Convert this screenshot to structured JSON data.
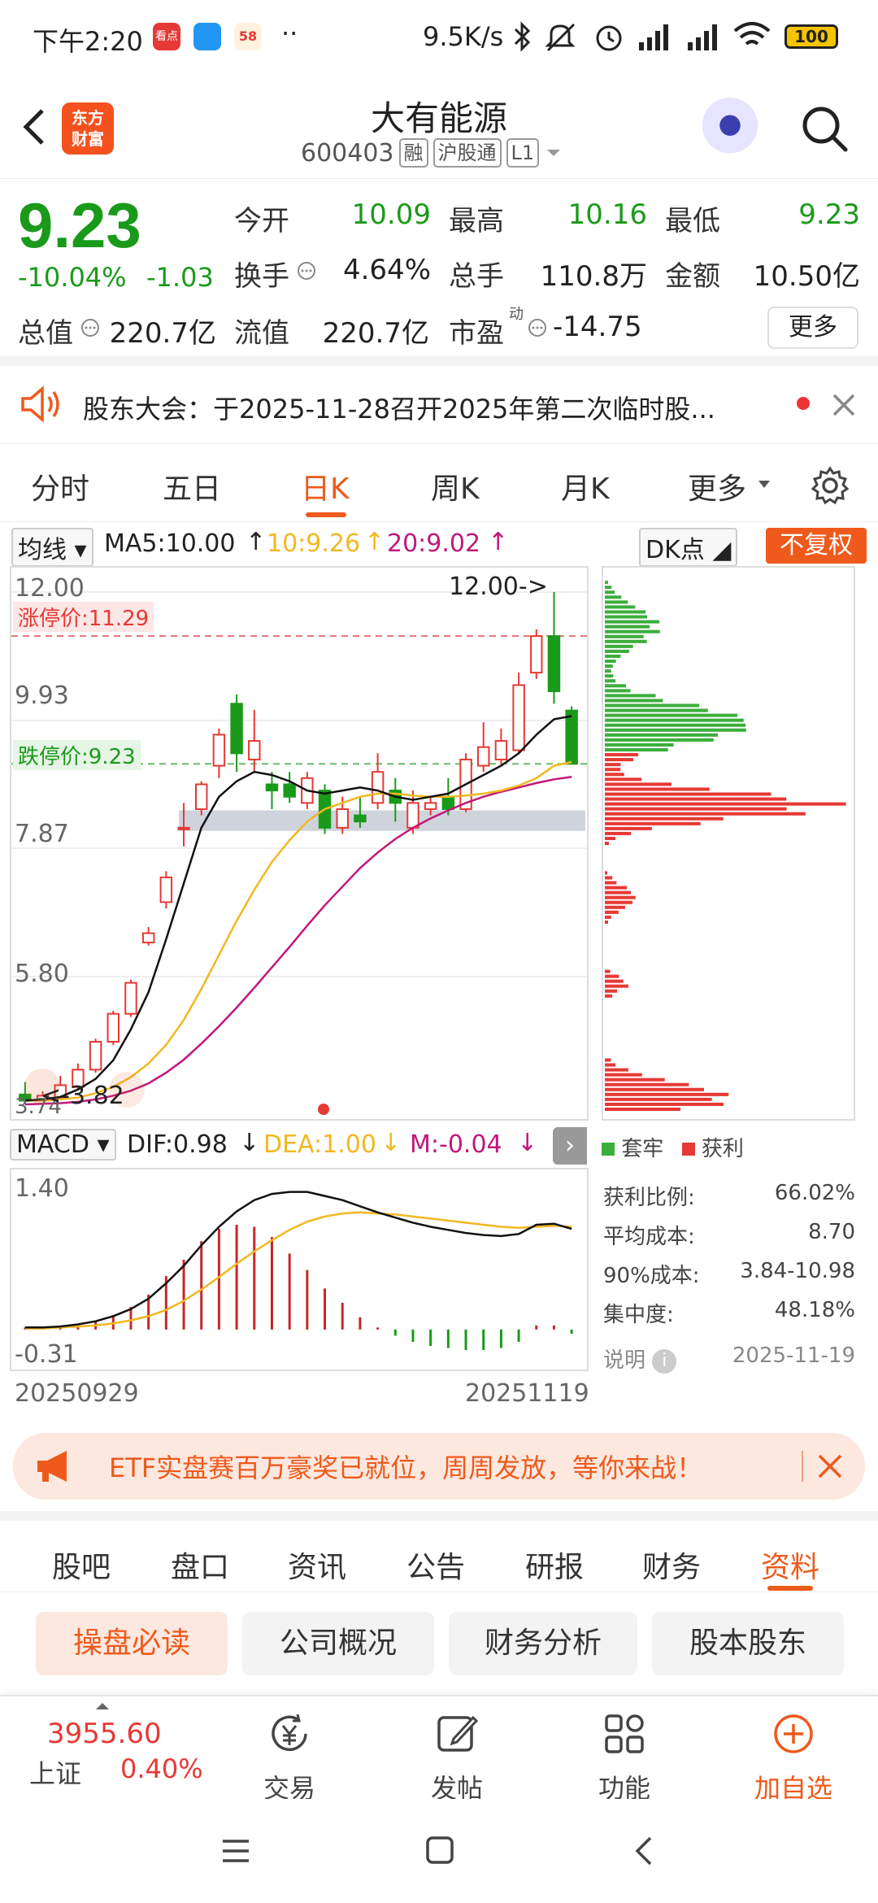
{
  "status_bar": {
    "time": "下午2:20",
    "app_icons": [
      "看点",
      "",
      "58"
    ],
    "dots": "··",
    "network_speed": "9.5K/s",
    "battery": "100"
  },
  "header": {
    "logo_text_1": "东方",
    "logo_text_2": "财富",
    "stock_name": "大有能源",
    "stock_code": "600403",
    "tags": [
      "融",
      "沪股通",
      "L1"
    ]
  },
  "quote": {
    "price": "9.23",
    "change_pct": "-10.04%",
    "change": "-1.03",
    "fields": [
      {
        "label": "今开",
        "value": "10.09",
        "color": "green"
      },
      {
        "label": "最高",
        "value": "10.16",
        "color": "green"
      },
      {
        "label": "最低",
        "value": "9.23",
        "color": "green"
      },
      {
        "label": "换手",
        "value": "4.64%",
        "color": "normal"
      },
      {
        "label": "总手",
        "value": "110.8万",
        "color": "normal"
      },
      {
        "label": "金额",
        "value": "10.50亿",
        "color": "normal"
      },
      {
        "label": "总值",
        "value": "220.7亿",
        "color": "normal"
      },
      {
        "label": "流值",
        "value": "220.7亿",
        "color": "normal"
      },
      {
        "label": "市盈",
        "value": "-14.75",
        "color": "normal"
      }
    ],
    "pe_superscript": "动",
    "more_label": "更多"
  },
  "notice": {
    "text": "股东大会：于2025-11-28召开2025年第二次临时股..."
  },
  "kline_tabs": [
    "分时",
    "五日",
    "日K",
    "周K",
    "月K",
    "更多"
  ],
  "kline_tab_active": "日K",
  "toolbar": {
    "indicator_select": "均线",
    "ma5": "MA5:10.00",
    "ma10": "10:9.26",
    "ma20": "20:9.02",
    "dk_select": "DK点",
    "fq_label": "不复权"
  },
  "main_chart": {
    "y_labels": [
      "12.00",
      "9.93",
      "7.87",
      "5.80",
      "3.74"
    ],
    "limit_up": "涨停价:11.29",
    "limit_down": "跌停价:9.23",
    "high_marker": "12.00->",
    "low_marker": "<-3.82",
    "colors": {
      "up": "#e53935",
      "down": "#1a9a1a",
      "ma5": "#111111",
      "ma10": "#f2b821",
      "ma20": "#c2187a"
    }
  },
  "chart_data": [
    {
      "type": "candlestick",
      "title": "",
      "ylim": [
        3.74,
        12.0
      ],
      "x_labels": [
        "20250929",
        "20251119"
      ],
      "candles": [
        {
          "o": 3.9,
          "c": 3.8,
          "h": 4.1,
          "l": 3.74
        },
        {
          "o": 3.82,
          "c": 3.88,
          "h": 3.95,
          "l": 3.8
        },
        {
          "o": 3.85,
          "c": 4.05,
          "h": 4.2,
          "l": 3.82
        },
        {
          "o": 4.02,
          "c": 4.3,
          "h": 4.4,
          "l": 3.98
        },
        {
          "o": 4.3,
          "c": 4.75,
          "h": 4.8,
          "l": 4.25
        },
        {
          "o": 4.75,
          "c": 5.2,
          "h": 5.25,
          "l": 4.7
        },
        {
          "o": 5.2,
          "c": 5.7,
          "h": 5.75,
          "l": 5.15
        },
        {
          "o": 6.35,
          "c": 6.5,
          "h": 6.6,
          "l": 6.3
        },
        {
          "o": 7.0,
          "c": 7.4,
          "h": 7.5,
          "l": 6.9
        },
        {
          "o": 8.2,
          "c": 8.2,
          "h": 8.6,
          "l": 7.9
        },
        {
          "o": 8.5,
          "c": 8.9,
          "h": 8.95,
          "l": 8.4
        },
        {
          "o": 9.2,
          "c": 9.7,
          "h": 9.8,
          "l": 9.0
        },
        {
          "o": 10.2,
          "c": 9.4,
          "h": 10.35,
          "l": 9.1
        },
        {
          "o": 9.3,
          "c": 9.6,
          "h": 10.1,
          "l": 9.1
        },
        {
          "o": 8.9,
          "c": 8.8,
          "h": 9.1,
          "l": 8.5
        },
        {
          "o": 8.9,
          "c": 8.7,
          "h": 9.1,
          "l": 8.6
        },
        {
          "o": 8.6,
          "c": 9.0,
          "h": 9.1,
          "l": 8.5
        },
        {
          "o": 8.8,
          "c": 8.2,
          "h": 8.9,
          "l": 8.1
        },
        {
          "o": 8.2,
          "c": 8.5,
          "h": 8.7,
          "l": 8.1
        },
        {
          "o": 8.4,
          "c": 8.3,
          "h": 8.7,
          "l": 8.2
        },
        {
          "o": 8.6,
          "c": 9.1,
          "h": 9.4,
          "l": 8.5
        },
        {
          "o": 8.8,
          "c": 8.6,
          "h": 9.0,
          "l": 8.3
        },
        {
          "o": 8.2,
          "c": 8.6,
          "h": 8.8,
          "l": 8.1
        },
        {
          "o": 8.5,
          "c": 8.6,
          "h": 8.7,
          "l": 8.4
        },
        {
          "o": 8.7,
          "c": 8.5,
          "h": 9.0,
          "l": 8.4
        },
        {
          "o": 8.5,
          "c": 9.3,
          "h": 9.4,
          "l": 8.45
        },
        {
          "o": 9.2,
          "c": 9.5,
          "h": 9.9,
          "l": 9.1
        },
        {
          "o": 9.3,
          "c": 9.6,
          "h": 9.8,
          "l": 9.2
        },
        {
          "o": 9.45,
          "c": 10.5,
          "h": 10.7,
          "l": 9.4
        },
        {
          "o": 10.7,
          "c": 11.29,
          "h": 11.4,
          "l": 10.6
        },
        {
          "o": 11.29,
          "c": 10.4,
          "h": 12.0,
          "l": 10.2
        },
        {
          "o": 10.09,
          "c": 9.23,
          "h": 10.16,
          "l": 9.23
        }
      ],
      "ma5": [
        3.8,
        3.82,
        3.86,
        3.98,
        4.15,
        4.45,
        4.95,
        5.55,
        6.4,
        7.3,
        8.2,
        8.7,
        8.95,
        9.1,
        9.05,
        8.95,
        8.8,
        8.75,
        8.8,
        8.85,
        8.8,
        8.7,
        8.65,
        8.7,
        8.75,
        8.9,
        9.05,
        9.2,
        9.4,
        9.7,
        9.95,
        10.0
      ],
      "ma10": [
        3.8,
        3.8,
        3.82,
        3.85,
        3.92,
        4.02,
        4.18,
        4.4,
        4.7,
        5.1,
        5.6,
        6.15,
        6.7,
        7.2,
        7.65,
        8.0,
        8.3,
        8.5,
        8.6,
        8.7,
        8.75,
        8.75,
        8.72,
        8.7,
        8.7,
        8.72,
        8.75,
        8.8,
        8.88,
        9.0,
        9.2,
        9.26
      ],
      "ma20": [
        3.74,
        3.75,
        3.76,
        3.78,
        3.82,
        3.88,
        3.96,
        4.08,
        4.25,
        4.46,
        4.72,
        5.0,
        5.3,
        5.62,
        5.95,
        6.28,
        6.62,
        6.95,
        7.25,
        7.55,
        7.8,
        8.02,
        8.2,
        8.35,
        8.48,
        8.6,
        8.7,
        8.78,
        8.85,
        8.92,
        8.98,
        9.02
      ]
    },
    {
      "type": "bar",
      "title": "MACD",
      "ylim": [
        -0.31,
        1.4
      ],
      "dif": [
        0.02,
        0.02,
        0.03,
        0.05,
        0.08,
        0.13,
        0.2,
        0.3,
        0.45,
        0.62,
        0.82,
        1.0,
        1.15,
        1.26,
        1.32,
        1.34,
        1.34,
        1.3,
        1.26,
        1.2,
        1.14,
        1.09,
        1.04,
        1.0,
        0.97,
        0.94,
        0.92,
        0.91,
        0.93,
        1.02,
        1.03,
        0.98
      ],
      "dea": [
        0.01,
        0.01,
        0.02,
        0.03,
        0.04,
        0.06,
        0.09,
        0.13,
        0.19,
        0.28,
        0.39,
        0.51,
        0.64,
        0.76,
        0.87,
        0.97,
        1.05,
        1.1,
        1.13,
        1.14,
        1.13,
        1.12,
        1.1,
        1.08,
        1.06,
        1.04,
        1.02,
        1.0,
        0.99,
        1.0,
        1.01,
        1.0
      ],
      "macd": [
        0.02,
        0.02,
        0.02,
        0.04,
        0.08,
        0.14,
        0.22,
        0.34,
        0.52,
        0.68,
        0.86,
        0.98,
        1.02,
        1.0,
        0.9,
        0.74,
        0.58,
        0.4,
        0.26,
        0.12,
        0.02,
        -0.06,
        -0.12,
        -0.16,
        -0.18,
        -0.2,
        -0.2,
        -0.18,
        -0.12,
        0.04,
        0.04,
        -0.04
      ]
    },
    {
      "type": "bar",
      "title": "筹码分布",
      "series": [
        {
          "name": "套牢",
          "color": "#3cae3c"
        },
        {
          "name": "获利",
          "color": "#e53935"
        }
      ],
      "profit_ratio": "66.02%",
      "avg_cost": "8.70",
      "cost_90": "3.84-10.98",
      "concentration": "48.18%"
    }
  ],
  "macd_bar": {
    "select": "MACD",
    "dif": "DIF:0.98",
    "dea": "DEA:1.00",
    "m": "M:-0.04",
    "y_top": "1.40",
    "y_bottom": "-0.31",
    "x_start": "20250929",
    "x_end": "20251119"
  },
  "chip": {
    "legend_trapped": "套牢",
    "legend_profit": "获利",
    "stats": [
      {
        "label": "获利比例:",
        "value": "66.02%"
      },
      {
        "label": "平均成本:",
        "value": "8.70"
      },
      {
        "label": "90%成本:",
        "value": "3.84-10.98"
      },
      {
        "label": "集中度:",
        "value": "48.18%"
      }
    ],
    "note_label": "说明",
    "date": "2025-11-19"
  },
  "ad": {
    "text": "ETF实盘赛百万豪奖已就位，周周发放，等你来战！"
  },
  "info_tabs": [
    "股吧",
    "盘口",
    "资讯",
    "公告",
    "研报",
    "财务",
    "资料"
  ],
  "info_tab_active": "资料",
  "sub_tabs": [
    "操盘必读",
    "公司概况",
    "财务分析",
    "股本股东"
  ],
  "sub_tab_active": "操盘必读",
  "bottom_bar": {
    "index_value": "3955.60",
    "index_name": "上证",
    "index_change": "0.40%",
    "items": [
      "交易",
      "发帖",
      "功能",
      "加自选"
    ]
  }
}
